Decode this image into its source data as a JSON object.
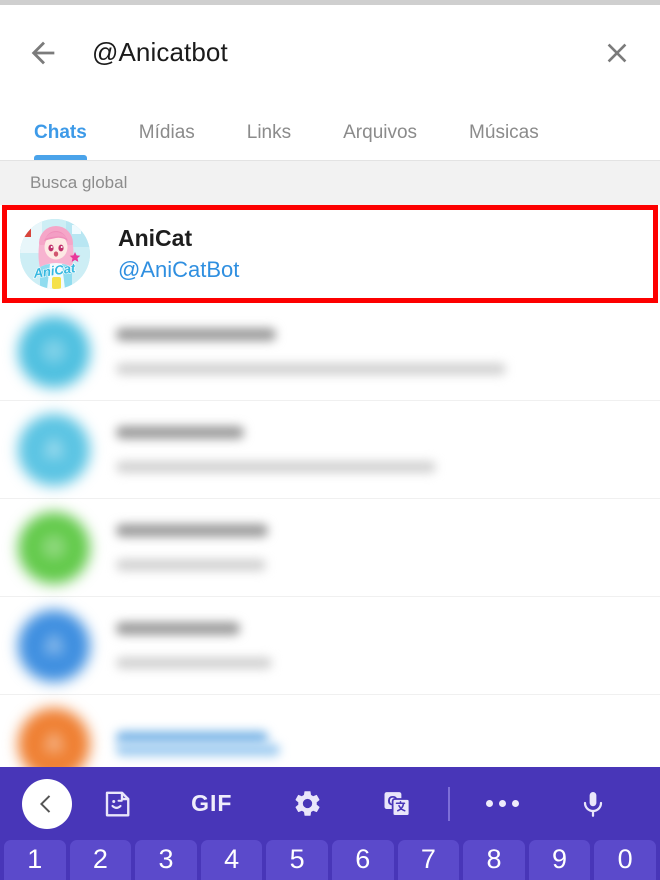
{
  "header": {
    "back_icon": "arrow-left-icon",
    "query": "@Anicatbot",
    "clear_icon": "close-icon"
  },
  "tabs": [
    {
      "label": "Chats",
      "active": true
    },
    {
      "label": "Mídias",
      "active": false
    },
    {
      "label": "Links",
      "active": false
    },
    {
      "label": "Arquivos",
      "active": false
    },
    {
      "label": "Músicas",
      "active": false
    }
  ],
  "section": {
    "global_search_label": "Busca global"
  },
  "result": {
    "title": "AniCat",
    "username": "@AniCatBot",
    "avatar_name": "anicat-bot-avatar",
    "highlighted": true,
    "highlight_color": "#fd0000"
  },
  "chat_list": [
    {
      "avatar_color": "#4fc0e0",
      "avatar_letter": "O",
      "redacted": true
    },
    {
      "avatar_color": "#5bc4e3",
      "avatar_letter": "A",
      "redacted": true
    },
    {
      "avatar_color": "#63ca4b",
      "avatar_letter": "O",
      "redacted": true
    },
    {
      "avatar_color": "#3f8fe0",
      "avatar_letter": "A",
      "redacted": true
    },
    {
      "avatar_color": "#ef8033",
      "avatar_letter": "A",
      "redacted": true
    }
  ],
  "keyboard": {
    "background_color": "#4836b8",
    "key_color": "#5b4acb",
    "toolbar": [
      {
        "name": "back-chevron-icon",
        "label": ""
      },
      {
        "name": "sticker-icon",
        "label": ""
      },
      {
        "name": "gif-icon",
        "label": "GIF"
      },
      {
        "name": "gear-icon",
        "label": ""
      },
      {
        "name": "google-translate-icon",
        "label": ""
      },
      {
        "name": "more-options-icon",
        "label": ""
      },
      {
        "name": "microphone-icon",
        "label": ""
      }
    ],
    "number_keys": [
      "1",
      "2",
      "3",
      "4",
      "5",
      "6",
      "7",
      "8",
      "9",
      "0"
    ]
  },
  "colors": {
    "accent_blue": "#3d9ae8",
    "link_blue": "#2f8fe0",
    "section_bg": "#f2f2f2",
    "highlight_red": "#fd0000",
    "keyboard_purple": "#4836b8"
  }
}
